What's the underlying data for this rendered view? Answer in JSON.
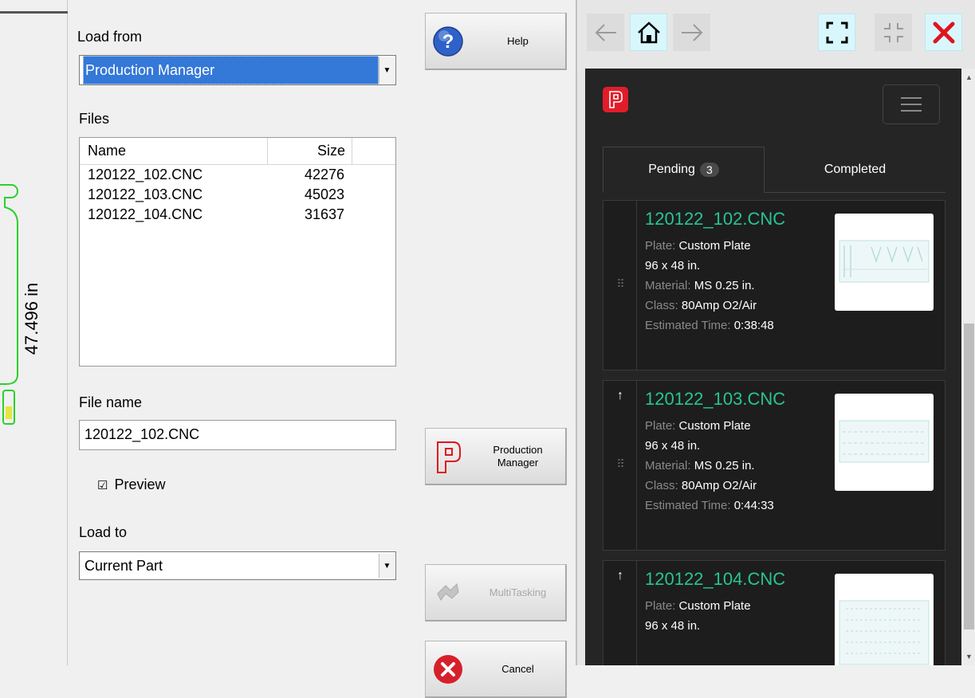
{
  "left_strip": {
    "dimension_label": "47.496 in"
  },
  "dialog": {
    "load_from": {
      "label": "Load from",
      "value": "Production Manager"
    },
    "files": {
      "label": "Files",
      "columns": [
        "Name",
        "Size"
      ],
      "rows": [
        {
          "name": "120122_102.CNC",
          "size": "42276"
        },
        {
          "name": "120122_103.CNC",
          "size": "45023"
        },
        {
          "name": "120122_104.CNC",
          "size": "31637"
        }
      ]
    },
    "file_name": {
      "label": "File name",
      "value": "120122_102.CNC"
    },
    "preview": {
      "label": "Preview",
      "checked": true
    },
    "load_to": {
      "label": "Load to",
      "value": "Current Part"
    }
  },
  "buttons": {
    "help": "Help",
    "production_manager_line1": "Production",
    "production_manager_line2": "Manager",
    "multitasking": "MultiTasking",
    "cancel": "Cancel"
  },
  "browser": {
    "colors": {
      "accent_green": "#28c494",
      "brand_red": "#e11d2a",
      "close_red": "#e0141e",
      "highlight": "#d8f7fd"
    },
    "toolbar_icons": [
      "back-arrow-icon",
      "home-icon",
      "forward-arrow-icon",
      "fullscreen-icon",
      "exit-fullscreen-icon",
      "close-icon"
    ],
    "tabs": {
      "pending": "Pending",
      "pending_count": "3",
      "completed": "Completed"
    },
    "jobs": [
      {
        "file": "120122_102.CNC",
        "plate_key": "Plate:",
        "plate": "Custom Plate",
        "size": "96 x 48 in.",
        "material_key": "Material:",
        "material": "MS 0.25 in.",
        "class_key": "Class:",
        "class": "80Amp O2/Air",
        "time_key": "Estimated Time:",
        "time": "0:38:48"
      },
      {
        "file": "120122_103.CNC",
        "plate_key": "Plate:",
        "plate": "Custom Plate",
        "size": "96 x 48 in.",
        "material_key": "Material:",
        "material": "MS 0.25 in.",
        "class_key": "Class:",
        "class": "80Amp O2/Air",
        "time_key": "Estimated Time:",
        "time": "0:44:33"
      },
      {
        "file": "120122_104.CNC",
        "plate_key": "Plate:",
        "plate": "Custom Plate",
        "size": "96 x 48 in."
      }
    ]
  }
}
